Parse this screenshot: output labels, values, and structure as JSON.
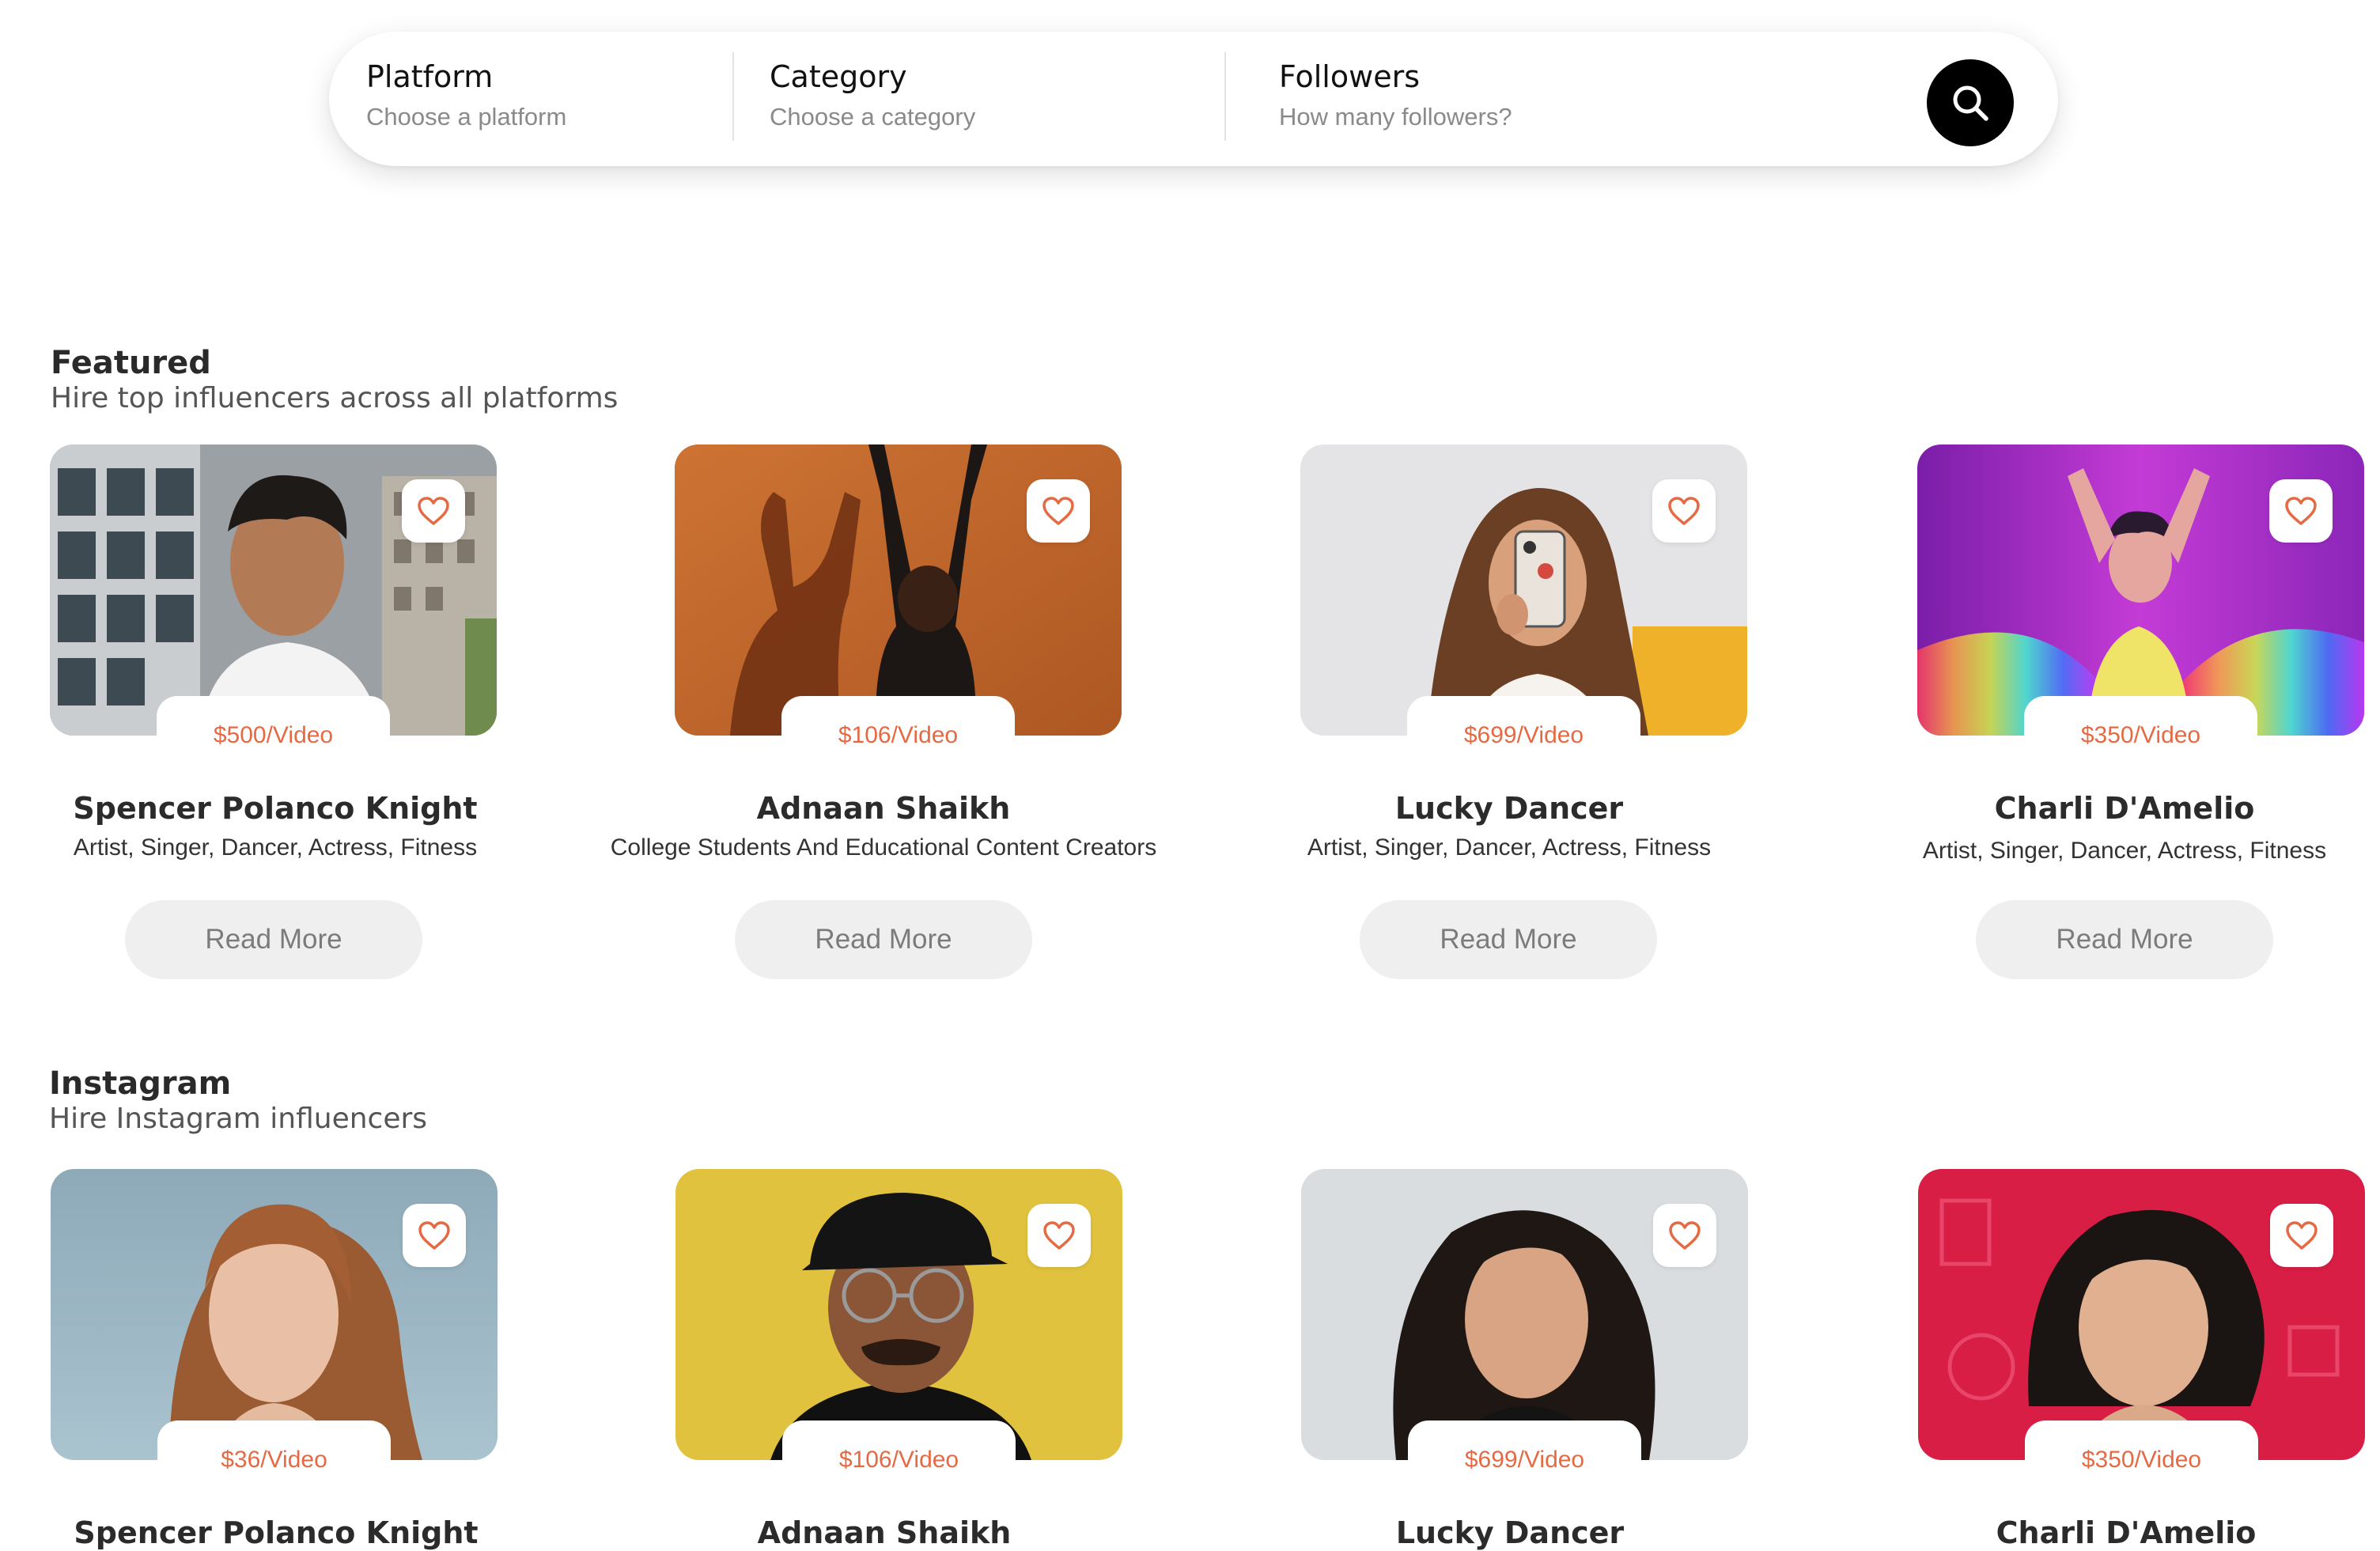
{
  "search": {
    "fields": [
      {
        "title": "Platform",
        "placeholder": "Choose a platform"
      },
      {
        "title": "Category",
        "placeholder": "Choose a category"
      },
      {
        "title": "Followers",
        "placeholder": "How many followers?"
      }
    ],
    "button_icon": "search-icon"
  },
  "sections": [
    {
      "title": "Featured",
      "subtitle": "Hire top influencers across all platforms",
      "cards": [
        {
          "price": "$500/Video",
          "name": "Spencer Polanco Knight",
          "categories": "Artist, Singer, Dancer, Actress, Fitness",
          "button": "Read More"
        },
        {
          "price": "$106/Video",
          "name": "Adnaan Shaikh",
          "categories": "College Students And Educational Content Creators",
          "button": "Read More"
        },
        {
          "price": "$699/Video",
          "name": "Lucky Dancer",
          "categories": "Artist, Singer, Dancer, Actress, Fitness",
          "button": "Read More"
        },
        {
          "price": "$350/Video",
          "name": "Charli D'Amelio",
          "categories": "Artist, Singer, Dancer, Actress, Fitness",
          "button": "Read More"
        }
      ]
    },
    {
      "title": "Instagram",
      "subtitle": "Hire Instagram influencers",
      "cards": [
        {
          "price": "$36/Video",
          "name": "Spencer Polanco Knight"
        },
        {
          "price": "$106/Video",
          "name": "Adnaan Shaikh"
        },
        {
          "price": "$699/Video",
          "name": "Lucky Dancer"
        },
        {
          "price": "$350/Video",
          "name": "Charli D'Amelio"
        }
      ]
    }
  ],
  "icons": {
    "favorite": "heart-icon",
    "search": "search-icon"
  },
  "colors": {
    "accent": "#e56a43",
    "search_button": "#000000",
    "read_more_bg": "#efefef"
  }
}
